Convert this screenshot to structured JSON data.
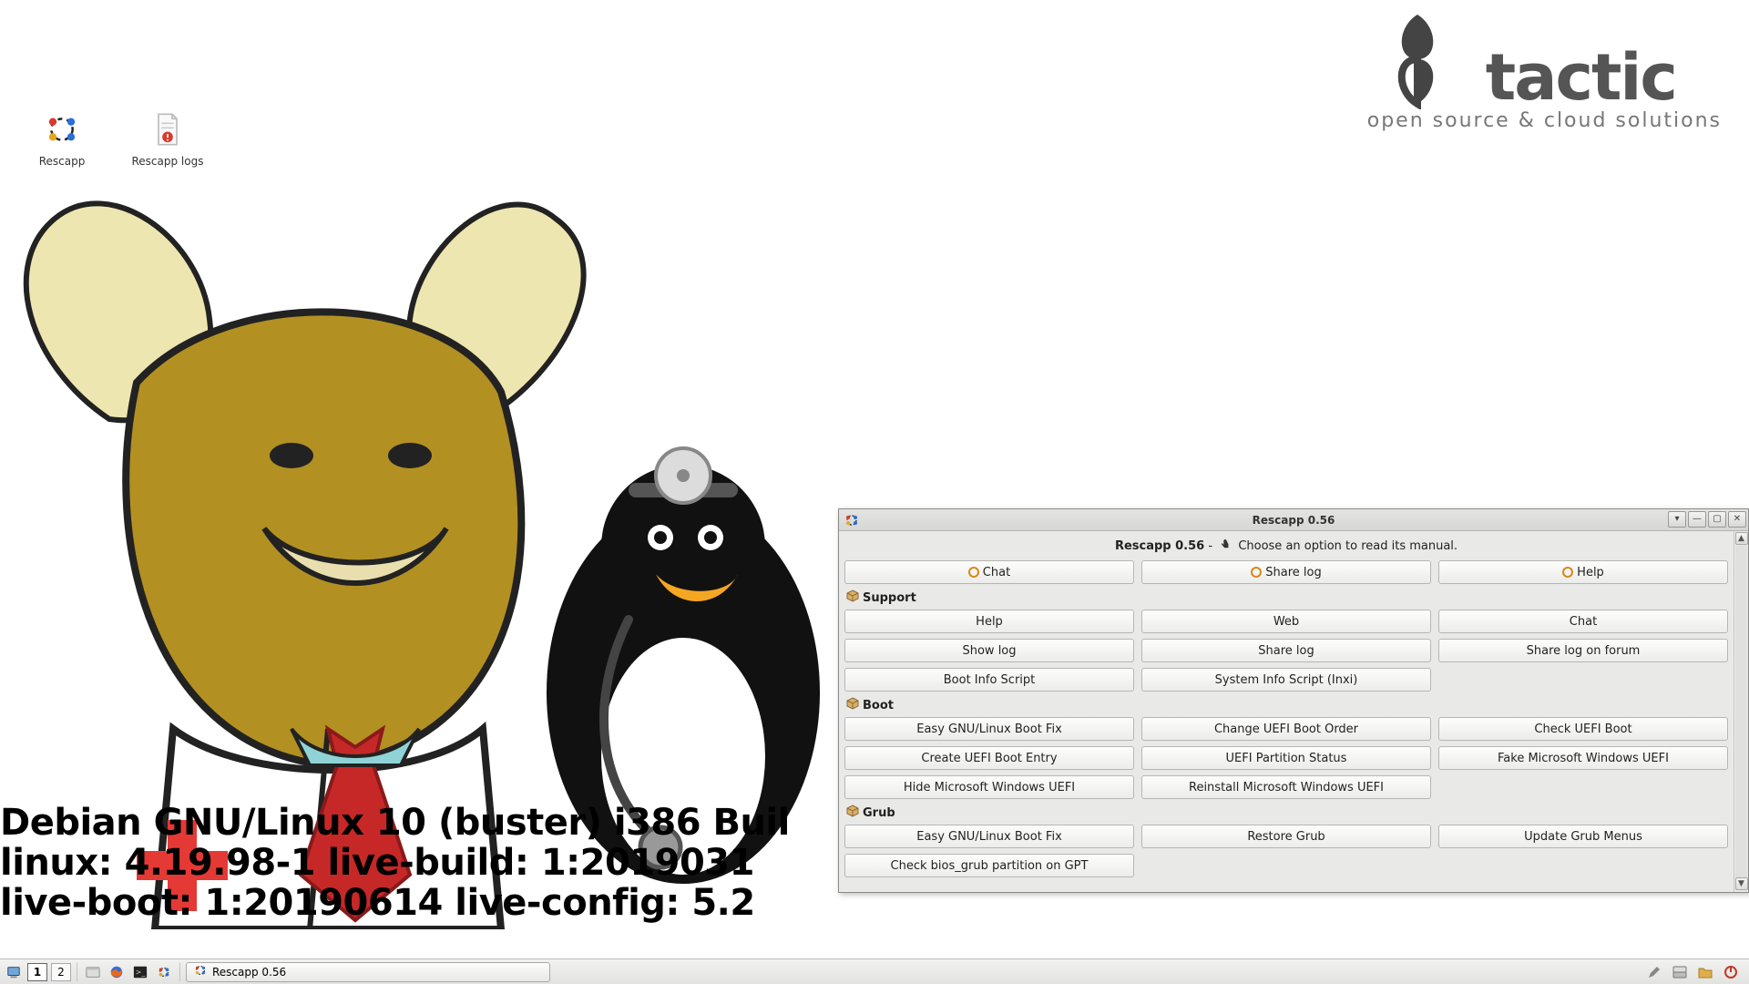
{
  "desktop": {
    "icons": [
      {
        "label": "Rescapp"
      },
      {
        "label": "Rescapp logs"
      }
    ]
  },
  "tactic": {
    "brand": "tactic",
    "subtitle": "open source & cloud solutions"
  },
  "debian_text": {
    "line1": "Debian GNU/Linux 10 (buster) i386 Buil",
    "line2": "linux: 4.19.98-1  live-build: 1:2019031",
    "line3": "live-boot: 1:20190614 live-config: 5.2"
  },
  "window": {
    "title": "Rescapp 0.56",
    "header_strong": "Rescapp 0.56",
    "header_sep": " - ",
    "header_tail": "Choose an option to read its manual.",
    "top_buttons": [
      "Chat",
      "Share log",
      "Help"
    ],
    "sections": [
      {
        "title": "Support",
        "rows": [
          [
            "Help",
            "Web",
            "Chat"
          ],
          [
            "Show log",
            "Share log",
            "Share log on forum"
          ],
          [
            "Boot Info Script",
            "System Info Script (Inxi)",
            null
          ]
        ]
      },
      {
        "title": "Boot",
        "rows": [
          [
            "Easy GNU/Linux Boot Fix",
            "Change UEFI Boot Order",
            "Check UEFI Boot"
          ],
          [
            "Create UEFI Boot Entry",
            "UEFI Partition Status",
            "Fake Microsoft Windows UEFI"
          ],
          [
            "Hide Microsoft Windows UEFI",
            "Reinstall Microsoft Windows UEFI",
            null
          ]
        ]
      },
      {
        "title": "Grub",
        "rows": [
          [
            "Easy GNU/Linux Boot Fix",
            "Restore Grub",
            "Update Grub Menus"
          ],
          [
            "Check bios_grub partition on GPT",
            null,
            null
          ]
        ]
      }
    ]
  },
  "taskbar": {
    "workspaces": [
      "1",
      "2"
    ],
    "active_workspace": 0,
    "task_label": "Rescapp 0.56"
  },
  "colors": {
    "gear": "#d88a1e",
    "package": "#c69a55"
  }
}
